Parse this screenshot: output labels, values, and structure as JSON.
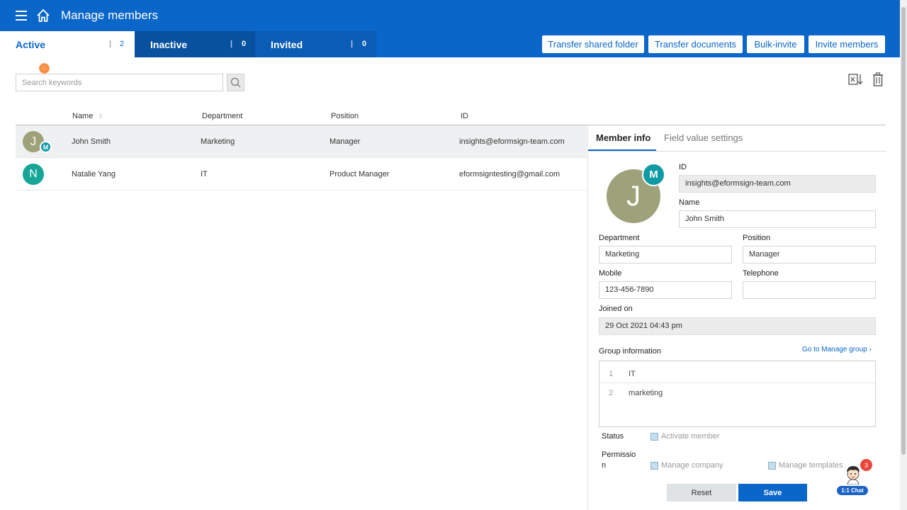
{
  "header": {
    "title": "Manage members"
  },
  "tabs": [
    {
      "label": "Active",
      "count": "2"
    },
    {
      "label": "Inactive",
      "count": "0"
    },
    {
      "label": "Invited",
      "count": "0"
    }
  ],
  "actions": {
    "transfer_shared_folder": "Transfer shared folder",
    "transfer_documents": "Transfer documents",
    "bulk_invite": "Bulk-invite",
    "invite_members": "Invite members"
  },
  "search": {
    "placeholder": "Search keywords",
    "value": ""
  },
  "table": {
    "headers": {
      "name": "Name",
      "department": "Department",
      "position": "Position",
      "id": "ID"
    },
    "rows": [
      {
        "initial": "J",
        "badge": "M",
        "name": "John Smith",
        "department": "Marketing",
        "position": "Manager",
        "id": "insights@eformsign-team.com",
        "avatar_color": "#9ea27a"
      },
      {
        "initial": "N",
        "badge": "",
        "name": "Natalie Yang",
        "department": "IT",
        "position": "Product Manager",
        "id": "eformsigntesting@gmail.com",
        "avatar_color": "#16a596"
      }
    ]
  },
  "panel": {
    "tab_member_info": "Member info",
    "tab_field_value": "Field value settings",
    "avatar_initial": "J",
    "avatar_badge": "M",
    "id_label": "ID",
    "id_value": "insights@eformsign-team.com",
    "name_label": "Name",
    "name_value": "John Smith",
    "department_label": "Department",
    "department_value": "Marketing",
    "position_label": "Position",
    "position_value": "Manager",
    "mobile_label": "Mobile",
    "mobile_value": "123-456-7890",
    "telephone_label": "Telephone",
    "telephone_value": "",
    "joined_label": "Joined on",
    "joined_value": "29 Oct 2021 04:43 pm",
    "group_label": "Group information",
    "group_link": "Go to Manage group",
    "groups": [
      {
        "num": "1",
        "name": "IT"
      },
      {
        "num": "2",
        "name": "marketing"
      }
    ],
    "status_label": "Status",
    "status_option": "Activate member",
    "permission_label_1": "Permissio",
    "permission_label_2": "n",
    "perm_manage_company": "Manage company",
    "perm_manage_templates": "Manage templates",
    "reset_label": "Reset",
    "save_label": "Save"
  },
  "chat": {
    "label": "1:1 Chat",
    "count": "3"
  },
  "colors": {
    "brand": "#0a66c9",
    "badge": "#0f9aa4",
    "notification": "#e8473c"
  }
}
